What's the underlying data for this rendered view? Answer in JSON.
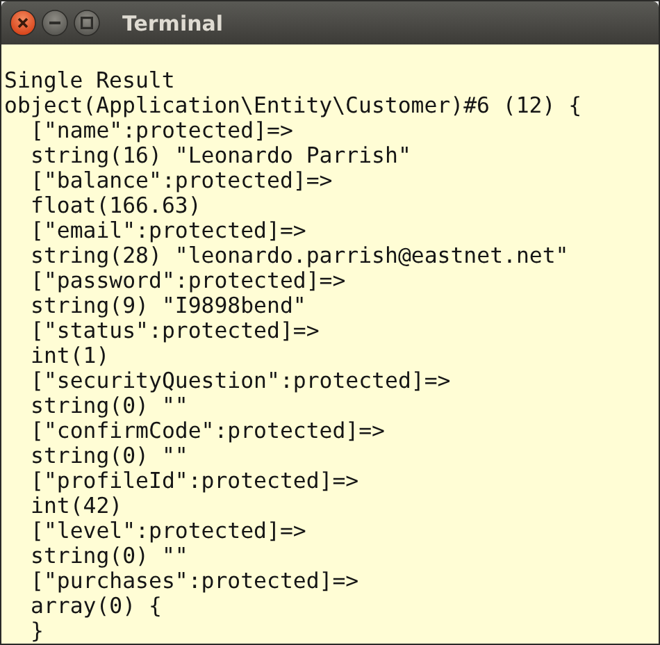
{
  "window": {
    "title": "Terminal"
  },
  "lines": [
    {
      "text": "Single Result",
      "indented": false
    },
    {
      "text": "object(Application\\Entity\\Customer)#6 (12) {",
      "indented": false
    },
    {
      "text": "[\"name\":protected]=>",
      "indented": true
    },
    {
      "text": "string(16) \"Leonardo Parrish\"",
      "indented": true
    },
    {
      "text": "[\"balance\":protected]=>",
      "indented": true
    },
    {
      "text": "float(166.63)",
      "indented": true
    },
    {
      "text": "[\"email\":protected]=>",
      "indented": true
    },
    {
      "text": "string(28) \"leonardo.parrish@eastnet.net\"",
      "indented": true
    },
    {
      "text": "[\"password\":protected]=>",
      "indented": true
    },
    {
      "text": "string(9) \"I9898bend\"",
      "indented": true
    },
    {
      "text": "[\"status\":protected]=>",
      "indented": true
    },
    {
      "text": "int(1)",
      "indented": true
    },
    {
      "text": "[\"securityQuestion\":protected]=>",
      "indented": true
    },
    {
      "text": "string(0) \"\"",
      "indented": true
    },
    {
      "text": "[\"confirmCode\":protected]=>",
      "indented": true
    },
    {
      "text": "string(0) \"\"",
      "indented": true
    },
    {
      "text": "[\"profileId\":protected]=>",
      "indented": true
    },
    {
      "text": "int(42)",
      "indented": true
    },
    {
      "text": "[\"level\":protected]=>",
      "indented": true
    },
    {
      "text": "string(0) \"\"",
      "indented": true
    },
    {
      "text": "[\"purchases\":protected]=>",
      "indented": true
    },
    {
      "text": "array(0) {",
      "indented": true
    },
    {
      "text": "}",
      "indented": true
    }
  ]
}
